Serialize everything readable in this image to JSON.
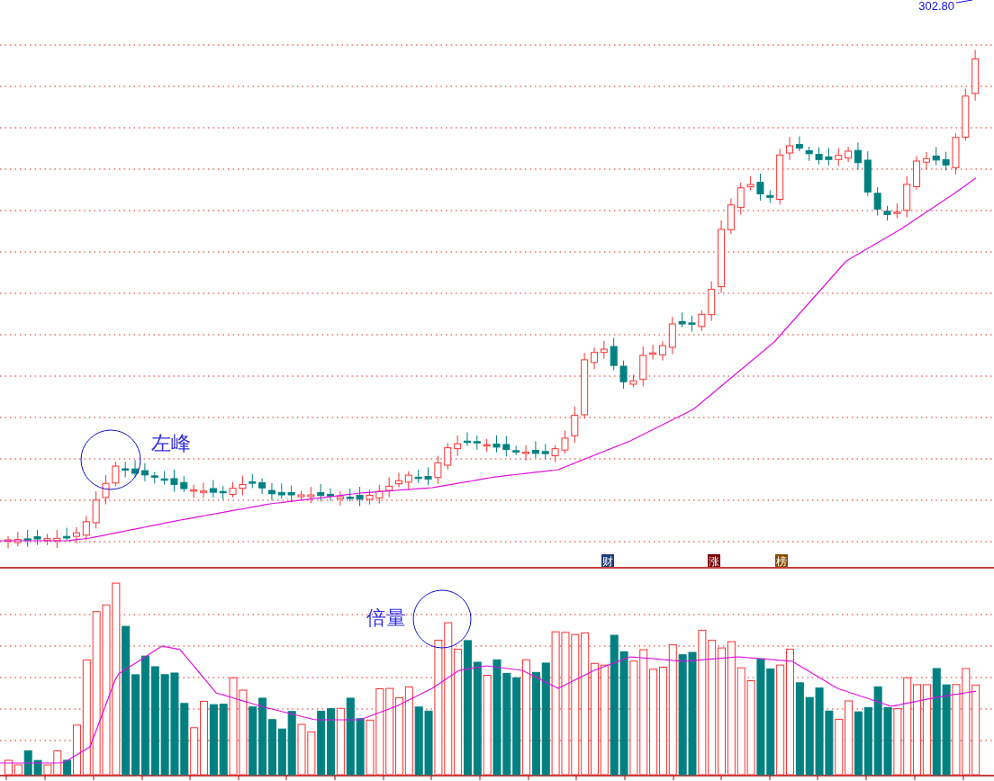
{
  "price_chart": {
    "latest_price_label": "302.80",
    "annotations": [
      {
        "text": "左峰"
      },
      {
        "text": "倍量"
      }
    ],
    "event_markers": [
      {
        "text": "财",
        "color": "#1b3f7a"
      },
      {
        "text": "涨",
        "color": "#7a0000"
      },
      {
        "text": "榜",
        "color": "#8a4a00"
      }
    ]
  }
}
